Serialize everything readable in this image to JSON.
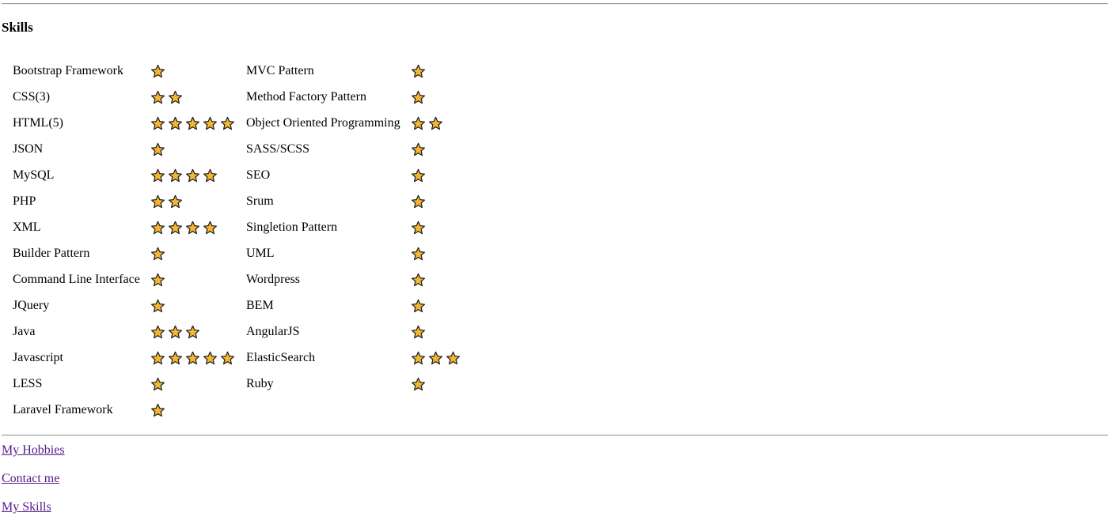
{
  "skills_section": {
    "title": "Skills",
    "star_color": "#f5b731",
    "star_outline": "#222222",
    "left_column": [
      {
        "name": "Bootstrap Framework",
        "rating": 1
      },
      {
        "name": "CSS(3)",
        "rating": 2
      },
      {
        "name": "HTML(5)",
        "rating": 5
      },
      {
        "name": "JSON",
        "rating": 1
      },
      {
        "name": "MySQL",
        "rating": 4
      },
      {
        "name": "PHP",
        "rating": 2
      },
      {
        "name": "XML",
        "rating": 4
      },
      {
        "name": "Builder Pattern",
        "rating": 1
      },
      {
        "name": "Command Line Interface",
        "rating": 1
      },
      {
        "name": "JQuery",
        "rating": 1
      },
      {
        "name": "Java",
        "rating": 3
      },
      {
        "name": "Javascript",
        "rating": 5
      },
      {
        "name": "LESS",
        "rating": 1
      },
      {
        "name": "Laravel Framework",
        "rating": 1
      }
    ],
    "right_column": [
      {
        "name": "MVC Pattern",
        "rating": 1
      },
      {
        "name": "Method Factory Pattern",
        "rating": 1
      },
      {
        "name": "Object Oriented Programming",
        "rating": 2
      },
      {
        "name": "SASS/SCSS",
        "rating": 1
      },
      {
        "name": "SEO",
        "rating": 1
      },
      {
        "name": "Srum",
        "rating": 1
      },
      {
        "name": "Singletion Pattern",
        "rating": 1
      },
      {
        "name": "UML",
        "rating": 1
      },
      {
        "name": "Wordpress",
        "rating": 1
      },
      {
        "name": "BEM",
        "rating": 1
      },
      {
        "name": "AngularJS",
        "rating": 1
      },
      {
        "name": "ElasticSearch",
        "rating": 3
      },
      {
        "name": "Ruby",
        "rating": 1
      }
    ]
  },
  "nav_links": {
    "hobbies": "My Hobbies",
    "contact": "Contact me",
    "skills": "My Skills",
    "link_color": "#551a8b"
  }
}
